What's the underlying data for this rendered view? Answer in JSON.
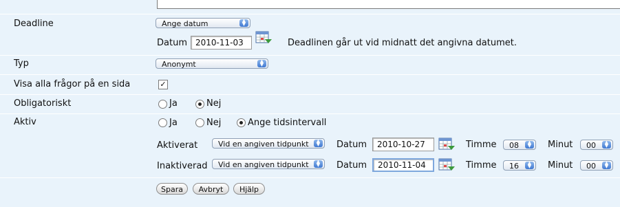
{
  "deadline": {
    "label": "Deadline",
    "select_value": "Ange datum",
    "datum_label": "Datum",
    "date_value": "2010-11-03",
    "note": "Deadlinen går ut vid midnatt det angivna datumet."
  },
  "typ": {
    "label": "Typ",
    "select_value": "Anonymt"
  },
  "visa": {
    "label": "Visa alla frågor på en sida",
    "checked_mark": "✓"
  },
  "obligatoriskt": {
    "label": "Obligatoriskt",
    "ja": "Ja",
    "nej": "Nej"
  },
  "aktiv": {
    "label": "Aktiv",
    "ja": "Ja",
    "nej": "Nej",
    "intervall": "Ange tidsintervall",
    "aktiverat": {
      "label": "Aktiverat",
      "mode": "Vid en angiven tidpunkt",
      "datum_label": "Datum",
      "date": "2010-10-27",
      "timme_label": "Timme",
      "timme": "08",
      "minut_label": "Minut",
      "minut": "00"
    },
    "inaktiverad": {
      "label": "Inaktiverad",
      "mode": "Vid en angiven tidpunkt",
      "datum_label": "Datum",
      "date": "2010-11-04",
      "timme_label": "Timme",
      "timme": "16",
      "minut_label": "Minut",
      "minut": "00"
    }
  },
  "buttons": {
    "save": "Spara",
    "cancel": "Avbryt",
    "help": "Hjälp"
  },
  "icons": {
    "calendar": "calendar-icon",
    "select_arrow": "updown-arrow-icon"
  }
}
